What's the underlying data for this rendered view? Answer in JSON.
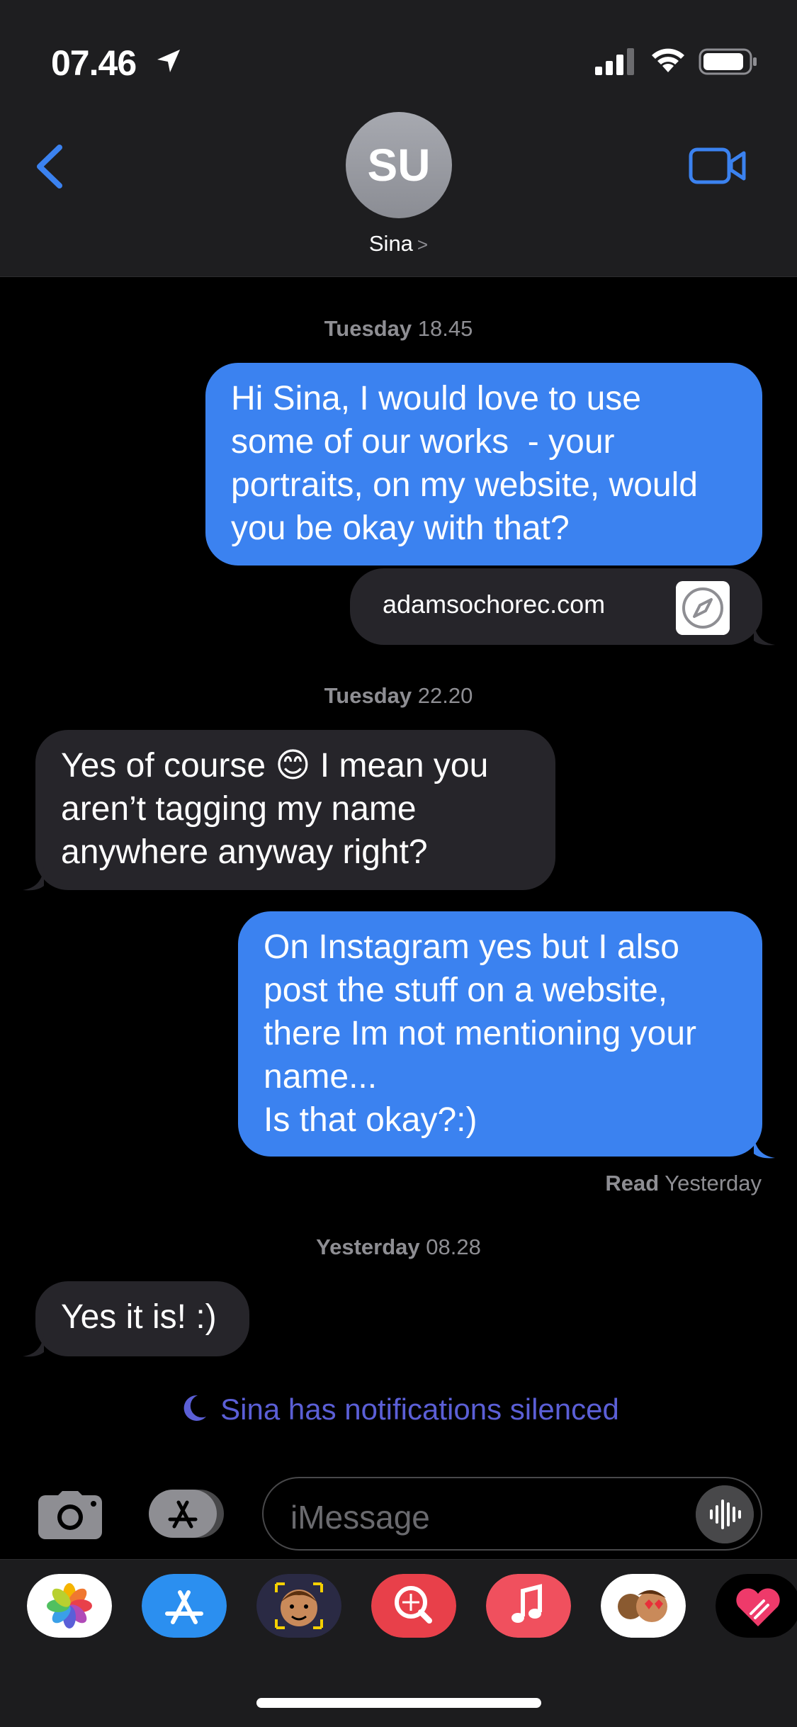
{
  "status_bar": {
    "time": "07.46"
  },
  "header": {
    "avatar_initials": "SU",
    "contact_name": "Sina",
    "contact_chevron": ">"
  },
  "conversation": {
    "timestamp_1": {
      "day": "Tuesday",
      "time": "18.45"
    },
    "msg_1": "Hi Sina, I would love to use\nsome of our works  - your\nportraits, on my website, would\nyou be okay with that?",
    "link_preview": "adamsochorec.com",
    "timestamp_2": {
      "day": "Tuesday",
      "time": "22.20"
    },
    "msg_2": "Yes of course 😊 I mean you\naren’t tagging my name\nanywhere anyway right?",
    "msg_3": "On Instagram yes but I also\npost the stuff on a website,\nthere Im not mentioning your\nname...\nIs that okay?:)",
    "read_receipt": {
      "label": "Read",
      "when": "Yesterday"
    },
    "timestamp_3": {
      "day": "Yesterday",
      "time": "08.28"
    },
    "msg_4": "Yes it is! :)",
    "silenced_notice": "Sina has notifications silenced"
  },
  "composer": {
    "placeholder": "iMessage"
  },
  "app_drawer": [
    {
      "name": "Photos",
      "icon": "photos-icon"
    },
    {
      "name": "App Store",
      "icon": "app-store-icon"
    },
    {
      "name": "Memoji",
      "icon": "memoji-icon"
    },
    {
      "name": "Search",
      "icon": "web-search-icon"
    },
    {
      "name": "Music",
      "icon": "music-icon"
    },
    {
      "name": "Memoji Stickers",
      "icon": "memoji-stickers-icon"
    },
    {
      "name": "Digital Touch",
      "icon": "digital-touch-icon"
    }
  ],
  "colors": {
    "outgoing": "#3b82f0",
    "incoming": "#26252a",
    "accent": "#3b82f0",
    "silenced": "#5b5fd6"
  }
}
